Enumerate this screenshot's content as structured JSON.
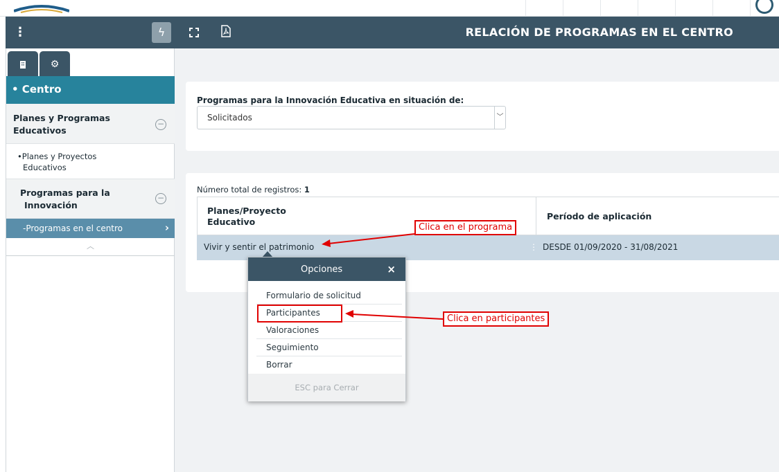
{
  "header": {
    "title": "RELACIÓN DE PROGRAMAS EN EL CENTRO"
  },
  "sidebar": {
    "section_title": "• Centro",
    "groups": [
      {
        "label_line1": "Planes y Programas",
        "label_line2": "Educativos"
      },
      {
        "label_line1": "Programas para la",
        "label_line2": "Innovación"
      }
    ],
    "items": [
      {
        "label_line1": "•Planes y Proyectos",
        "label_line2": "Educativos"
      },
      {
        "label": "-Programas en el centro"
      }
    ]
  },
  "filter": {
    "label": "Programas para la Innovación Educativa en situación de:",
    "selected": "Solicitados"
  },
  "results": {
    "total_label": "Número total de registros:",
    "total_value": "1",
    "columns": {
      "col1_line1": "Planes/Proyecto",
      "col1_line2": "Educativo",
      "col2": "Período de aplicación"
    },
    "rows": [
      {
        "plan": "Vivir y sentir el patrimonio",
        "period": "DESDE 01/09/2020 - 31/08/2021"
      }
    ]
  },
  "popup": {
    "title": "Opciones",
    "close": "×",
    "options": [
      "Formulario de solicitud",
      "Participantes",
      "Valoraciones",
      "Seguimiento",
      "Borrar"
    ],
    "footer": "ESC para Cerrar"
  },
  "annotations": {
    "callout_program": "Clica en el programa",
    "callout_participants": "Clica en participantes",
    "color": "#e00000"
  },
  "colors": {
    "topbar": "#3b5566",
    "section_header": "#27839c",
    "active_item": "#5a8eaa",
    "selected_row": "#c9d8e4"
  }
}
